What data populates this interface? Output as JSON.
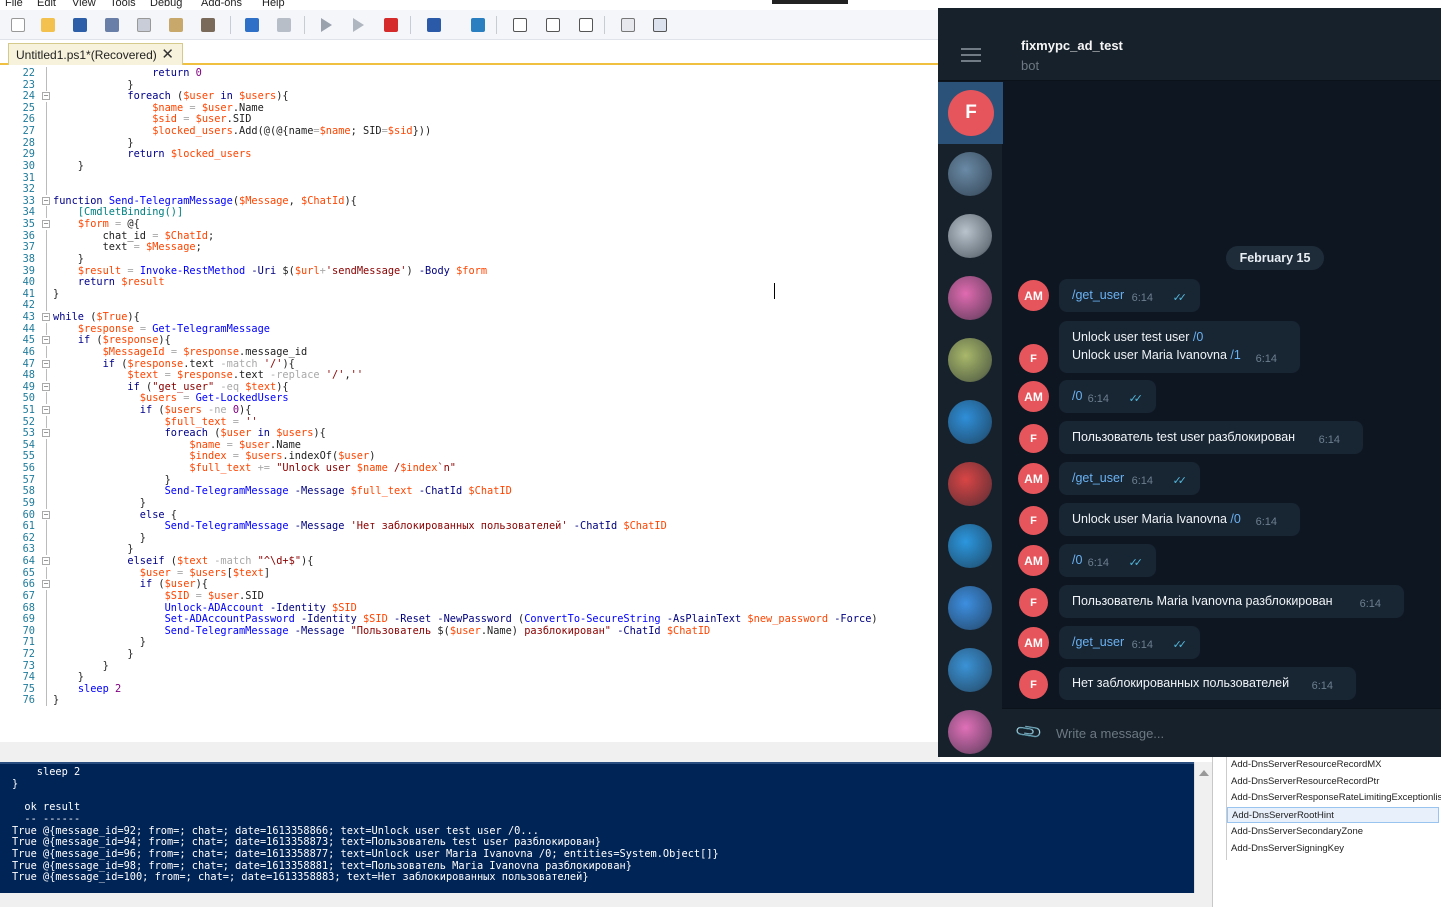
{
  "ise": {
    "menu": [
      "File",
      "Edit",
      "View",
      "Tools",
      "Debug",
      "Add-ons",
      "Help"
    ],
    "toolbar_icons": [
      "new-file-icon",
      "open-folder-icon",
      "save-icon",
      "cut-icon",
      "copy-icon",
      "paste-icon",
      "clear-icon",
      "undo-icon",
      "redo-icon",
      "run-icon",
      "run-selection-icon",
      "stop-icon",
      "remote-icon",
      "console-icon",
      "layout-top-icon",
      "layout-right-icon",
      "layout-max-icon",
      "snippets-icon",
      "command-addon-icon"
    ],
    "tab_label": "Untitled1.ps1*(Recovered)",
    "tab_close": "✕",
    "lines": [
      {
        "n": "22",
        "html": "                <span class=\"kw\">return</span> <span class=\"nb\">0</span>"
      },
      {
        "n": "23",
        "html": "            }"
      },
      {
        "n": "24",
        "html": "            <span class=\"kw\">foreach</span> (<span class=\"vr\">$user</span> <span class=\"kw\">in</span> <span class=\"vr\">$users</span>){",
        "fold": true
      },
      {
        "n": "25",
        "html": "                <span class=\"vr\">$name</span> <span class=\"op\">=</span> <span class=\"vr\">$user</span>.Name"
      },
      {
        "n": "26",
        "html": "                <span class=\"vr\">$sid</span> <span class=\"op\">=</span> <span class=\"vr\">$user</span>.SID"
      },
      {
        "n": "27",
        "html": "                <span class=\"vr\">$locked_users</span>.Add(@(@{name<span class=\"op\">=</span><span class=\"vr\">$name</span>; SID<span class=\"op\">=</span><span class=\"vr\">$sid</span>}))"
      },
      {
        "n": "28",
        "html": "            }"
      },
      {
        "n": "29",
        "html": "            <span class=\"kw\">return</span> <span class=\"vr\">$locked_users</span>"
      },
      {
        "n": "30",
        "html": "    }"
      },
      {
        "n": "31",
        "html": ""
      },
      {
        "n": "32",
        "html": ""
      },
      {
        "n": "33",
        "html": "<span class=\"kw\">function</span> <span class=\"cm\">Send-TelegramMessage</span>(<span class=\"vr\">$Message</span>, <span class=\"vr\">$ChatId</span>){",
        "fold": true
      },
      {
        "n": "34",
        "html": "    <span class=\"ty\">[CmdletBinding()]</span>"
      },
      {
        "n": "35",
        "html": "    <span class=\"vr\">$form</span> <span class=\"op\">=</span> @{",
        "fold": true
      },
      {
        "n": "36",
        "html": "        chat_id <span class=\"op\">=</span> <span class=\"vr\">$ChatId</span>;"
      },
      {
        "n": "37",
        "html": "        text <span class=\"op\">=</span> <span class=\"vr\">$Message</span>;"
      },
      {
        "n": "38",
        "html": "    }"
      },
      {
        "n": "39",
        "html": "    <span class=\"vr\">$result</span> <span class=\"op\">=</span> <span class=\"cm\">Invoke-RestMethod</span> <span class=\"pm\">-Uri</span> $(<span class=\"vr\">$url</span><span class=\"op\">+</span><span class=\"st\">'sendMessage'</span>) <span class=\"pm\">-Body</span> <span class=\"vr\">$form</span>"
      },
      {
        "n": "40",
        "html": "    <span class=\"kw\">return</span> <span class=\"vr\">$result</span>"
      },
      {
        "n": "41",
        "html": "}"
      },
      {
        "n": "42",
        "html": ""
      },
      {
        "n": "43",
        "html": "<span class=\"kw\">while</span> (<span class=\"vr\">$True</span>){",
        "fold": true
      },
      {
        "n": "44",
        "html": "    <span class=\"vr\">$response</span> <span class=\"op\">=</span> <span class=\"cm\">Get-TelegramMessage</span>"
      },
      {
        "n": "45",
        "html": "    <span class=\"kw\">if</span> (<span class=\"vr\">$response</span>){",
        "fold": true
      },
      {
        "n": "46",
        "html": "        <span class=\"vr\">$MessageId</span> <span class=\"op\">=</span> <span class=\"vr\">$response</span>.message_id"
      },
      {
        "n": "47",
        "html": "        <span class=\"kw\">if</span> (<span class=\"vr\">$response</span>.text <span class=\"op\">-match</span> <span class=\"st\">'/'</span>){",
        "fold": true
      },
      {
        "n": "48",
        "html": "            <span class=\"vr\">$text</span> <span class=\"op\">=</span> <span class=\"vr\">$response</span>.text <span class=\"op\">-replace</span> <span class=\"st\">'/'</span>,<span class=\"st\">''</span>"
      },
      {
        "n": "49",
        "html": "            <span class=\"kw\">if</span> (<span class=\"st\">\"get_user\"</span> <span class=\"op\">-eq</span> <span class=\"vr\">$text</span>){",
        "fold": true
      },
      {
        "n": "50",
        "html": "              <span class=\"vr\">$users</span> <span class=\"op\">=</span> <span class=\"cm\">Get-LockedUsers</span>"
      },
      {
        "n": "51",
        "html": "              <span class=\"kw\">if</span> (<span class=\"vr\">$users</span> <span class=\"op\">-ne</span> <span class=\"nb\">0</span>){",
        "fold": true
      },
      {
        "n": "52",
        "html": "                  <span class=\"vr\">$full_text</span> <span class=\"op\">=</span> <span class=\"st\">''</span>"
      },
      {
        "n": "53",
        "html": "                  <span class=\"kw\">foreach</span> (<span class=\"vr\">$user</span> <span class=\"kw\">in</span> <span class=\"vr\">$users</span>){",
        "fold": true
      },
      {
        "n": "54",
        "html": "                      <span class=\"vr\">$name</span> <span class=\"op\">=</span> <span class=\"vr\">$user</span>.Name"
      },
      {
        "n": "55",
        "html": "                      <span class=\"vr\">$index</span> <span class=\"op\">=</span> <span class=\"vr\">$users</span>.indexOf(<span class=\"vr\">$user</span>)"
      },
      {
        "n": "56",
        "html": "                      <span class=\"vr\">$full_text</span> <span class=\"op\">+=</span> <span class=\"st\">\"Unlock user </span><span class=\"vr\">$name</span><span class=\"st\"> /</span><span class=\"vr\">$index</span><span class=\"st\">`n\"</span>"
      },
      {
        "n": "57",
        "html": "                  }"
      },
      {
        "n": "58",
        "html": "                  <span class=\"cm\">Send-TelegramMessage</span> <span class=\"pm\">-Message</span> <span class=\"vr\">$full_text</span> <span class=\"pm\">-ChatId</span> <span class=\"vr\">$ChatID</span>"
      },
      {
        "n": "59",
        "html": "              }"
      },
      {
        "n": "60",
        "html": "              <span class=\"kw\">else</span> {",
        "fold": true
      },
      {
        "n": "61",
        "html": "                  <span class=\"cm\">Send-TelegramMessage</span> <span class=\"pm\">-Message</span> <span class=\"st\">'Нет заблокированных пользователей'</span> <span class=\"pm\">-ChatId</span> <span class=\"vr\">$ChatID</span>"
      },
      {
        "n": "62",
        "html": "              }"
      },
      {
        "n": "63",
        "html": "            }"
      },
      {
        "n": "64",
        "html": "            <span class=\"kw\">elseif</span> (<span class=\"vr\">$text</span> <span class=\"op\">-match</span> <span class=\"st\">\"^\\d+$\"</span>){",
        "fold": true
      },
      {
        "n": "65",
        "html": "              <span class=\"vr\">$user</span> <span class=\"op\">=</span> <span class=\"vr\">$users</span>[<span class=\"vr\">$text</span>]"
      },
      {
        "n": "66",
        "html": "              <span class=\"kw\">if</span> (<span class=\"vr\">$user</span>){",
        "fold": true
      },
      {
        "n": "67",
        "html": "                  <span class=\"vr\">$SID</span> <span class=\"op\">=</span> <span class=\"vr\">$user</span>.SID"
      },
      {
        "n": "68",
        "html": "                  <span class=\"cm\">Unlock-ADAccount</span> <span class=\"pm\">-Identity</span> <span class=\"vr\">$SID</span>"
      },
      {
        "n": "69",
        "html": "                  <span class=\"cm\">Set-ADAccountPassword</span> <span class=\"pm\">-Identity</span> <span class=\"vr\">$SID</span> <span class=\"pm\">-Reset</span> <span class=\"pm\">-NewPassword</span> (<span class=\"cm\">ConvertTo-SecureString</span> <span class=\"pm\">-AsPlainText</span> <span class=\"vr\">$new_password</span> <span class=\"pm\">-Force</span>)"
      },
      {
        "n": "70",
        "html": "                  <span class=\"cm\">Send-TelegramMessage</span> <span class=\"pm\">-Message</span> <span class=\"st\">\"Пользователь </span>$(<span class=\"vr\">$user</span>.Name)<span class=\"st\"> разблокирован\"</span> <span class=\"pm\">-ChatId</span> <span class=\"vr\">$ChatID</span>"
      },
      {
        "n": "71",
        "html": "              }"
      },
      {
        "n": "72",
        "html": "            }"
      },
      {
        "n": "73",
        "html": "        }"
      },
      {
        "n": "74",
        "html": "    }"
      },
      {
        "n": "75",
        "html": "    <span class=\"cm\">sleep</span> <span class=\"nb\">2</span>"
      },
      {
        "n": "76",
        "html": "}"
      }
    ],
    "console": [
      "    sleep 2",
      "}",
      "",
      "  ok result",
      "  -- ------",
      "True @{message_id=92; from=; chat=; date=1613358866; text=Unlock user test user /0...",
      "True @{message_id=94; from=; chat=; date=1613358873; text=Пользователь test user разблокирован}",
      "True @{message_id=96; from=; chat=; date=1613358877; text=Unlock user Maria Ivanovna /0; entities=System.Object[]}",
      "True @{message_id=98; from=; chat=; date=1613358881; text=Пользователь Maria Ivanovna разблокирован}",
      "True @{message_id=100; from=; chat=; date=1613358883; text=Нет заблокированных пользователей}"
    ],
    "commands": [
      "Add-DnsServerResourceRecordMX",
      "Add-DnsServerResourceRecordPtr",
      "Add-DnsServerResponseRateLimitingExceptionlist",
      "Add-DnsServerRootHint",
      "Add-DnsServerSecondaryZone",
      "Add-DnsServerSigningKey"
    ],
    "selected_command_index": 3
  },
  "telegram": {
    "chat_title": "fixmypc_ad_test",
    "chat_subtitle": "bot",
    "menu_icon": "hamburger-menu-icon",
    "active_chat_initial": "F",
    "sidebar_avatar_colors": [
      "#6a8aa6",
      "#b9c3cc",
      "#e06bb0",
      "#a9b86a",
      "#2f8fd8",
      "#d94545",
      "#2c97de",
      "#3d8fe0",
      "#3b93d6",
      "#e070b8"
    ],
    "date": "February 15",
    "messages": [
      {
        "from": "AM",
        "lines": [
          "/get_user"
        ],
        "link": true,
        "time": "6:14",
        "check": "✓✓"
      },
      {
        "from": "F",
        "lines": [
          "Unlock user test user /0",
          "Unlock user Maria Ivanovna /1"
        ],
        "time": "6:14"
      },
      {
        "from": "AM",
        "lines": [
          "/0"
        ],
        "link": true,
        "time": "6:14",
        "check": "✓✓"
      },
      {
        "from": "F",
        "lines": [
          "Пользователь test user разблокирован"
        ],
        "time": "6:14"
      },
      {
        "from": "AM",
        "lines": [
          "/get_user"
        ],
        "link": true,
        "time": "6:14",
        "check": "✓✓"
      },
      {
        "from": "F",
        "lines": [
          "Unlock user Maria Ivanovna /0"
        ],
        "time": "6:14"
      },
      {
        "from": "AM",
        "lines": [
          "/0"
        ],
        "link": true,
        "time": "6:14",
        "check": "✓✓"
      },
      {
        "from": "F",
        "lines": [
          "Пользователь Maria Ivanovna разблокирован"
        ],
        "time": "6:14"
      },
      {
        "from": "AM",
        "lines": [
          "/get_user"
        ],
        "link": true,
        "time": "6:14",
        "check": "✓✓"
      },
      {
        "from": "F",
        "lines": [
          "Нет заблокированных пользователей"
        ],
        "time": "6:14"
      }
    ],
    "input_placeholder": "Write a message...",
    "attach_icon": "paperclip-icon"
  }
}
